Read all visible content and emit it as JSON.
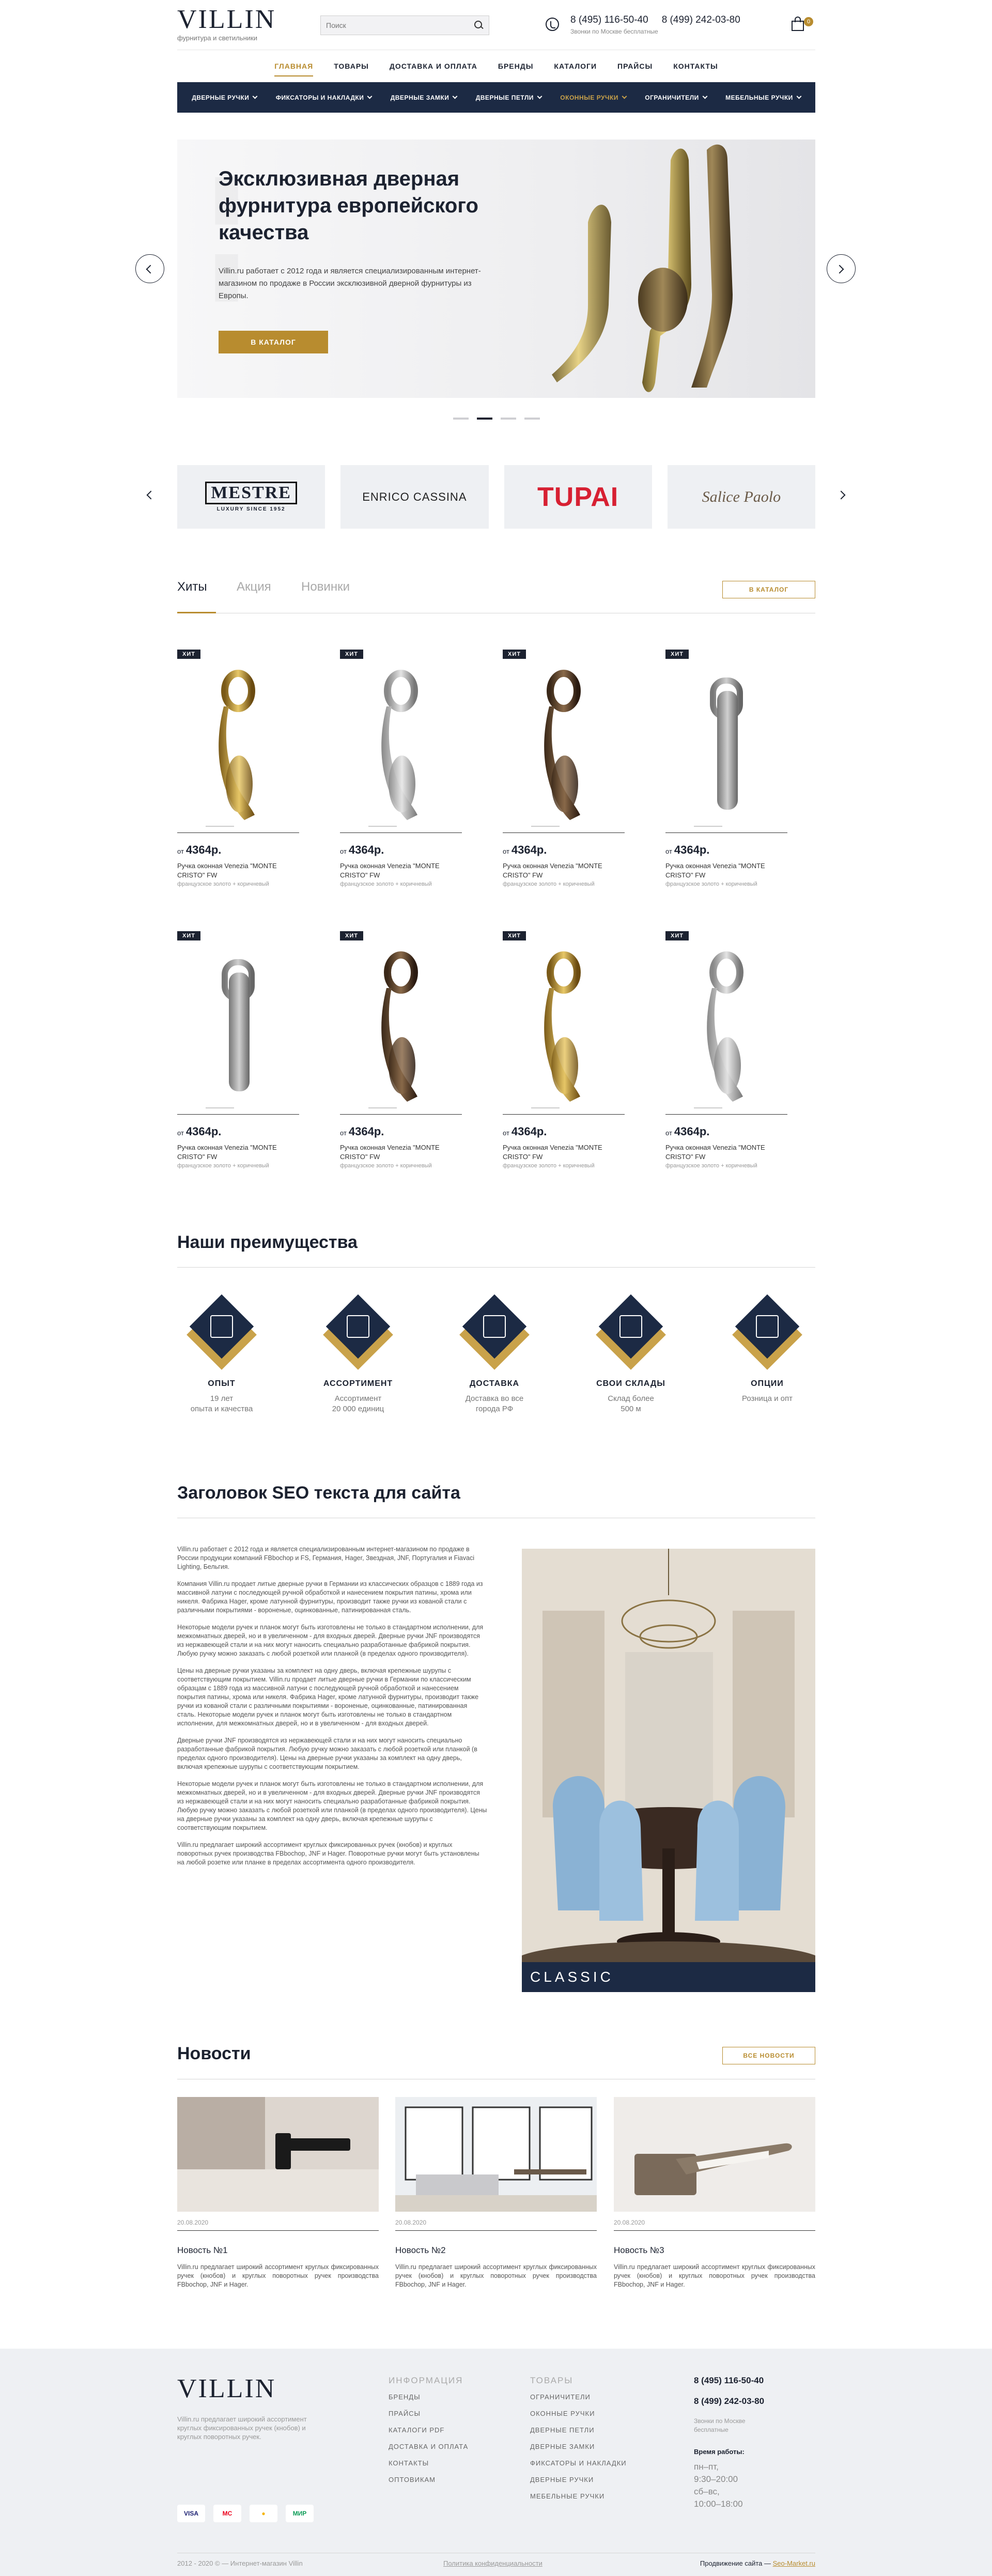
{
  "header": {
    "logo": "VILLIN",
    "tagline": "фурнитура и светильники",
    "search_placeholder": "Поиск",
    "phone1": "8 (495) 116-50-40",
    "phone2": "8 (499) 242-03-80",
    "phone_note": "Звонки по Москве бесплатные",
    "cart_count": "0"
  },
  "topnav": [
    "ГЛАВНАЯ",
    "ТОВАРЫ",
    "ДОСТАВКА И ОПЛАТА",
    "БРЕНДЫ",
    "КАТАЛОГИ",
    "ПРАЙСЫ",
    "КОНТАКТЫ"
  ],
  "catbar": [
    "ДВЕРНЫЕ РУЧКИ",
    "ФИКСАТОРЫ И НАКЛАДКИ",
    "ДВЕРНЫЕ ЗАМКИ",
    "ДВЕРНЫЕ ПЕТЛИ",
    "ОКОННЫЕ РУЧКИ",
    "ОГРАНИЧИТЕЛИ",
    "МЕБЕЛЬНЫЕ РУЧКИ"
  ],
  "hero": {
    "title": "Эксклюзивная дверная фурнитура европейского качества",
    "text": "Villin.ru работает с 2012 года и является специализированным интернет-магазином по продаже в России эксклюзивной дверной фурнитуры из Европы.",
    "button": "В КАТАЛОГ"
  },
  "brands": {
    "mestre": "MESTRE",
    "mestre_sub": "LUXURY SINCE 1952",
    "enrico": "ENRICO CASSINA",
    "tupai": "TUPAI",
    "salice": "Salice Paolo"
  },
  "tabs": {
    "items": [
      "Хиты",
      "Акция",
      "Новинки"
    ],
    "catalog_button": "В КАТАЛОГ"
  },
  "product_common": {
    "badge": "ХИТ",
    "price_prefix": "от",
    "price": "4364р.",
    "name": "Ручка оконная Venezia \"MONTE CRISTO\" FW",
    "sub": "французское золото + коричневый"
  },
  "advantages": {
    "title": "Наши преимущества",
    "items": [
      {
        "title": "ОПЫТ",
        "text1": "19 лет",
        "text2": "опыта и качества"
      },
      {
        "title": "АССОРТИМЕНТ",
        "text1": "Ассортимент",
        "text2": "20 000 единиц"
      },
      {
        "title": "ДОСТАВКА",
        "text1": "Доставка во все",
        "text2": "города РФ"
      },
      {
        "title": "СВОИ СКЛАДЫ",
        "text1": "Склад более",
        "text2": "500 м"
      },
      {
        "title": "ОПЦИИ",
        "text1": "Розница и опт",
        "text2": ""
      }
    ]
  },
  "seo": {
    "title": "Заголовок SEO текста для сайта",
    "paragraphs": [
      "Villin.ru работает с 2012 года и является специализированным интернет-магазином по продаже в России продукции компаний FBbochop и FS, Германия, Hager, Звездная, JNF, Португалия и Fiavaci Lighting, Бельгия.",
      "Компания Villin.ru продает литые дверные ручки в Германии из классических образцов с 1889 года из массивной латуни с последующей ручной обработкой и нанесением покрытия патины, хрома или никеля. Фабрика Hager, кроме латунной фурнитуры, производит также ручки из кованой стали с различными покрытиями - вороненые, оцинкованные, патинированная сталь.",
      "Некоторые модели ручек и планок могут быть изготовлены не только в стандартном исполнении, для межкомнатных дверей, но и в увеличенном - для входных дверей. Дверные ручки JNF производятся из нержавеющей стали и на них могут наносить специально разработанные фабрикой покрытия. Любую ручку можно заказать с любой розеткой или планкой (в пределах одного производителя).",
      "Цены на дверные ручки указаны за комплект на одну дверь, включая крепежные шурупы с соответствующим покрытием. Villin.ru продает литые дверные ручки в Германии по классическим образцам с 1889 года из массивной латуни с последующей ручной обработкой и нанесением покрытия патины, хрома или никеля. Фабрика Hager, кроме латунной фурнитуры, производит также ручки из кованой стали с различными покрытиями - вороненые, оцинкованные, патинированная сталь. Некоторые модели ручек и планок могут быть изготовлены не только в стандартном исполнении, для межкомнатных дверей, но и в увеличенном - для входных дверей.",
      "Дверные ручки JNF производятся из нержавеющей стали и на них могут наносить специально разработанные фабрикой покрытия. Любую ручку можно заказать с любой розеткой или планкой (в пределах одного производителя). Цены на дверные ручки указаны за комплект на одну дверь, включая крепежные шурупы с соответствующим покрытием.",
      "Некоторые модели ручек и планок могут быть изготовлены не только в стандартном исполнении, для межкомнатных дверей, но и в увеличенном - для входных дверей. Дверные ручки JNF производятся из нержавеющей стали и на них могут наносить специально разработанные фабрикой покрытия. Любую ручку можно заказать с любой розеткой или планкой (в пределах одного производителя). Цены на дверные ручки указаны за комплект на одну дверь, включая крепежные шурупы с соответствующим покрытием.",
      "Villin.ru предлагает широкий ассортимент круглых фиксированных ручек (кнобов) и круглых поворотных ручек производства FBbochop, JNF и Hager. Поворотные ручки могут быть установлены на любой розетке или планке в пределах ассортимента одного производителя."
    ],
    "image_caption": "CLASSIC"
  },
  "news": {
    "title": "Новости",
    "all_button": "ВСЕ НОВОСТИ",
    "items": [
      {
        "date": "20.08.2020",
        "title": "Новость №1",
        "text": "Villin.ru предлагает широкий ассортимент круглых фиксированных ручек (кнобов) и круглых поворотных ручек производства FBbochop, JNF и Hager."
      },
      {
        "date": "20.08.2020",
        "title": "Новость №2",
        "text": "Villin.ru предлагает широкий ассортимент круглых фиксированных ручек (кнобов) и круглых поворотных ручек производства FBbochop, JNF и Hager."
      },
      {
        "date": "20.08.2020",
        "title": "Новость №3",
        "text": "Villin.ru предлагает широкий ассортимент круглых фиксированных ручек (кнобов) и круглых поворотных ручек производства FBbochop, JNF и Hager."
      }
    ]
  },
  "footer": {
    "logo": "VILLIN",
    "about": "Villin.ru предлагает широкий ассортимент круглых фиксированных ручек (кнобов) и круглых поворотных ручек.",
    "payments": [
      "VISA",
      "MC",
      "●",
      "МИР"
    ],
    "info_title": "ИНФОРМАЦИЯ",
    "info_links": [
      "БРЕНДЫ",
      "ПРАЙСЫ",
      "КАТАЛОГИ PDF",
      "ДОСТАВКА И ОПЛАТА",
      "КОНТАКТЫ",
      "ОПТОВИКАМ"
    ],
    "goods_title": "ТОВАРЫ",
    "goods_links": [
      "ОГРАНИЧИТЕЛИ",
      "ОКОННЫЕ РУЧКИ",
      "ДВЕРНЫЕ ПЕТЛИ",
      "ДВЕРНЫЕ ЗАМКИ",
      "ФИКСАТОРЫ И НАКЛАДКИ",
      "ДВЕРНЫЕ РУЧКИ",
      "МЕБЕЛЬНЫЕ РУЧКИ"
    ],
    "phone1": "8 (495) 116-50-40",
    "phone2": "8 (499) 242-03-80",
    "phone_note": "Звонки по Москве бесплатные",
    "hours_title": "Время работы:",
    "hours": [
      "пн–пт,",
      "9:30–20:00",
      "сб–вс,",
      "10:00–18:00"
    ],
    "copyright": "2012 - 2020 © — Интернет-магазин Villin",
    "privacy": "Политика конфиденциальности",
    "dev_prefix": "Продвижение сайта —",
    "dev_name": "Seo-Market.ru"
  }
}
